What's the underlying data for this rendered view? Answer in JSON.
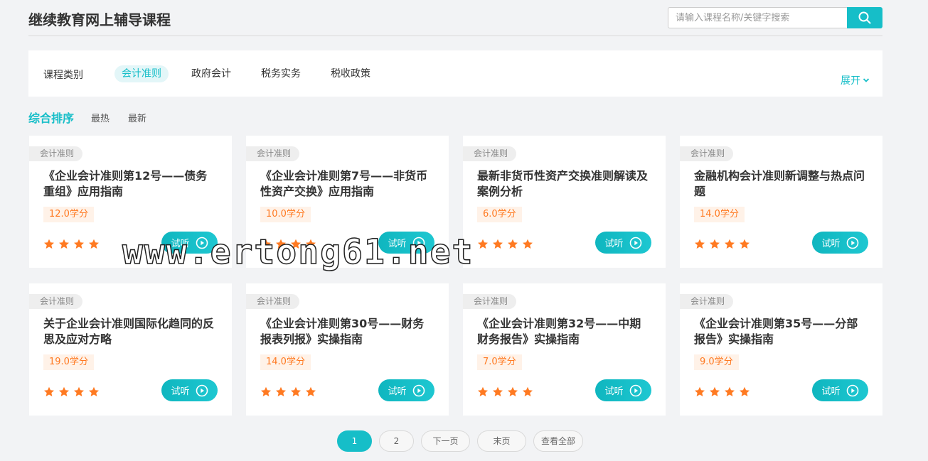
{
  "header": {
    "title": "继续教育网上辅导课程",
    "search_placeholder": "请输入课程名称/关键字搜索",
    "search_icon": "search-icon"
  },
  "filter": {
    "label": "课程类别",
    "tabs": [
      {
        "label": "会计准则",
        "active": true
      },
      {
        "label": "政府会计",
        "active": false
      },
      {
        "label": "税务实务",
        "active": false
      },
      {
        "label": "税收政策",
        "active": false
      }
    ],
    "expand_label": "展开"
  },
  "sort": {
    "items": [
      {
        "label": "综合排序",
        "active": true
      },
      {
        "label": "最热",
        "active": false
      },
      {
        "label": "最新",
        "active": false
      }
    ]
  },
  "courses": [
    {
      "tag": "会计准则",
      "title": "《企业会计准则第12号——债务\n重组》应用指南",
      "credit": "12.0学分",
      "stars": 4,
      "button": "试听"
    },
    {
      "tag": "会计准则",
      "title": "《企业会计准则第7号——非货币\n性资产交换》应用指南",
      "credit": "10.0学分",
      "stars": 4,
      "button": "试听"
    },
    {
      "tag": "会计准则",
      "title": "最新非货币性资产交换准则解读及\n案例分析",
      "credit": "6.0学分",
      "stars": 4,
      "button": "试听"
    },
    {
      "tag": "会计准则",
      "title": "金融机构会计准则新调整与热点问\n题",
      "credit": "14.0学分",
      "stars": 4,
      "button": "试听"
    },
    {
      "tag": "会计准则",
      "title": "关于企业会计准则国际化趋同的反\n思及应对方略",
      "credit": "19.0学分",
      "stars": 4,
      "button": "试听"
    },
    {
      "tag": "会计准则",
      "title": "《企业会计准则第30号——财务\n报表列报》实操指南",
      "credit": "14.0学分",
      "stars": 4,
      "button": "试听"
    },
    {
      "tag": "会计准则",
      "title": "《企业会计准则第32号——中期\n财务报告》实操指南",
      "credit": "7.0学分",
      "stars": 4,
      "button": "试听"
    },
    {
      "tag": "会计准则",
      "title": "《企业会计准则第35号——分部\n报告》实操指南",
      "credit": "9.0学分",
      "stars": 4,
      "button": "试听"
    }
  ],
  "pagination": {
    "pages": [
      "1",
      "2"
    ],
    "current": "1",
    "next_label": "下一页",
    "last_label": "末页",
    "all_label": "查看全部"
  },
  "watermark": "www.ertong61.net",
  "colors": {
    "accent": "#16bec8",
    "credit_text": "#ff7a22",
    "credit_bg": "#fff2e8",
    "star": "#ff7a22"
  }
}
